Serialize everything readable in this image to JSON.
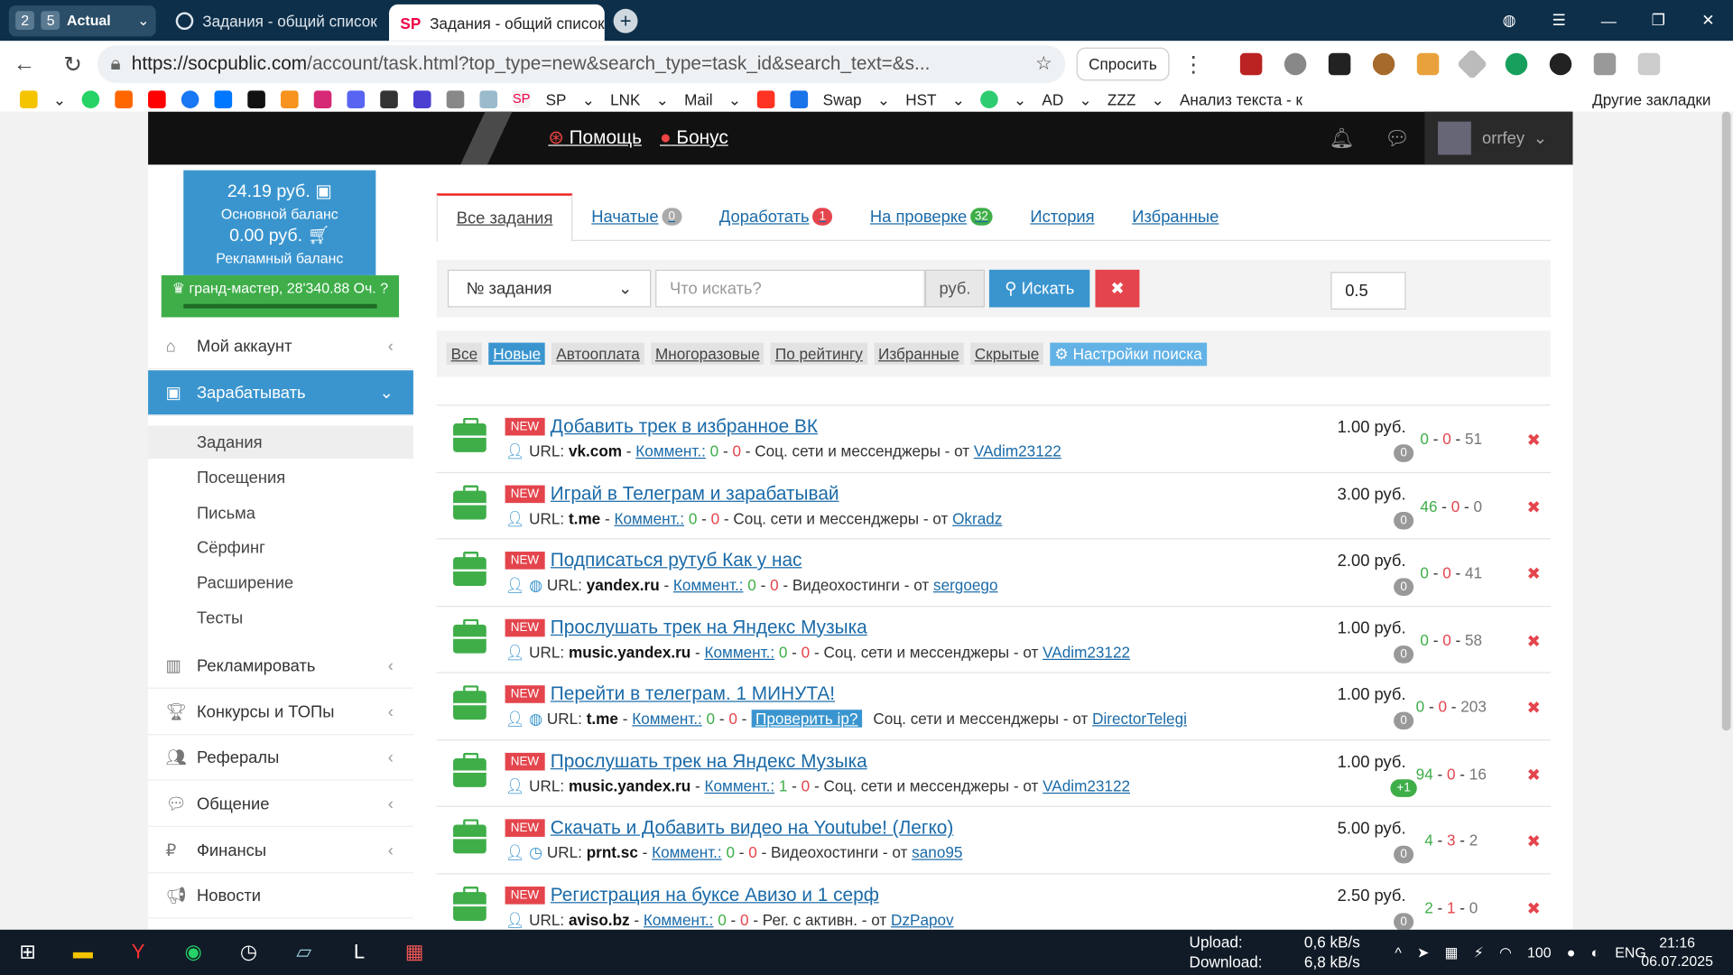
{
  "browser": {
    "workspace": {
      "number": "2",
      "count": "5",
      "name": "Actual"
    },
    "tabs": [
      {
        "label": "Задания - общий список"
      },
      {
        "label": "Задания - общий список"
      }
    ],
    "url_host": "https://socpublic.com",
    "url_rest": "/account/task.html?top_type=new&search_type=task_id&search_text=&s...",
    "ask_label": "Спросить",
    "bookmarks": [
      "SP",
      "LNK",
      "Mail",
      "Swap",
      "HST",
      "AD",
      "ZZZ",
      "Анализ текста - к"
    ],
    "other_bookmarks": "Другие закладки"
  },
  "site": {
    "help": "Помощь",
    "bonus": "Бонус",
    "username": "orrfey",
    "balance_main": "24.19 руб.",
    "balance_main_label": "Основной баланс",
    "balance_ad": "0.00 руб.",
    "balance_ad_label": "Рекламный баланс",
    "rank": "гранд-мастер, 28'340.88 Оч."
  },
  "sidebar": {
    "items": [
      {
        "label": "Мой аккаунт",
        "icon": "home-icon"
      },
      {
        "label": "Зарабатывать",
        "icon": "briefcase-icon"
      },
      {
        "label": "Рекламировать",
        "icon": "chart-icon"
      },
      {
        "label": "Конкурсы и ТОПы",
        "icon": "trophy-icon"
      },
      {
        "label": "Рефералы",
        "icon": "users-icon"
      },
      {
        "label": "Общение",
        "icon": "chat-icon"
      },
      {
        "label": "Финансы",
        "icon": "ruble-icon"
      },
      {
        "label": "Новости",
        "icon": "megaphone-icon"
      }
    ],
    "subitems": [
      "Задания",
      "Посещения",
      "Письма",
      "Сёрфинг",
      "Расширение",
      "Тесты"
    ]
  },
  "main": {
    "tabs": [
      {
        "label": "Все задания"
      },
      {
        "label": "Начатые",
        "badge": "0"
      },
      {
        "label": "Доработать",
        "badge": "1"
      },
      {
        "label": "На проверке",
        "badge": "32"
      },
      {
        "label": "История"
      },
      {
        "label": "Избранные"
      }
    ],
    "search": {
      "type": "№ задания",
      "placeholder": "Что искать?",
      "price": "0.5",
      "currency": "руб.",
      "button": "Искать"
    },
    "filters": [
      "Все",
      "Новые",
      "Автооплата",
      "Многоразовые",
      "По рейтингу",
      "Избранные",
      "Скрытые",
      "Настройки поиска"
    ]
  },
  "tasks": [
    {
      "badge": "NEW",
      "title": "Добавить трек в избранное ВК",
      "url": "vk.com",
      "comment": "Коммент.:",
      "c1": "0",
      "c2": "0",
      "category": "Соц. сети и мессенджеры",
      "author": "VAdim23122",
      "price": "1.00 руб.",
      "count": "0",
      "s1": "0",
      "s2": "0",
      "s3": "51"
    },
    {
      "badge": "NEW",
      "title": "Играй в Телеграм и зарабатывай",
      "url": "t.me",
      "comment": "Коммент.:",
      "c1": "0",
      "c2": "0",
      "category": "Соц. сети и мессенджеры",
      "author": "Okradz",
      "price": "3.00 руб.",
      "count": "0",
      "s1": "46",
      "s2": "0",
      "s3": "0"
    },
    {
      "badge": "NEW",
      "title": "Подписаться рутуб Как у нас",
      "url": "yandex.ru",
      "comment": "Коммент.:",
      "c1": "0",
      "c2": "0",
      "category": "Видеохостинги",
      "author": "sergoego",
      "price": "2.00 руб.",
      "count": "0",
      "s1": "0",
      "s2": "0",
      "s3": "41"
    },
    {
      "badge": "NEW",
      "title": "Прослушать трек на Яндекс Музыка",
      "url": "music.yandex.ru",
      "comment": "Коммент.:",
      "c1": "0",
      "c2": "0",
      "category": "Соц. сети и мессенджеры",
      "author": "VAdim23122",
      "price": "1.00 руб.",
      "count": "0",
      "s1": "0",
      "s2": "0",
      "s3": "58"
    },
    {
      "badge": "NEW",
      "title": "Перейти в телеграм. 1 МИНУТА!",
      "url": "t.me",
      "comment": "Коммент.:",
      "c1": "0",
      "c2": "0",
      "check": "Проверить ip?",
      "category": "Соц. сети и мессенджеры",
      "author": "DirectorTelegi",
      "price": "1.00 руб.",
      "count": "0",
      "s1": "0",
      "s2": "0",
      "s3": "203"
    },
    {
      "badge": "NEW",
      "title": "Прослушать трек на Яндекс Музыка",
      "url": "music.yandex.ru",
      "comment": "Коммент.:",
      "c1": "1",
      "c2": "0",
      "category": "Соц. сети и мессенджеры",
      "author": "VAdim23122",
      "price": "1.00 руб.",
      "count": "+1",
      "s1": "94",
      "s2": "0",
      "s3": "16"
    },
    {
      "badge": "NEW",
      "title": "Скачать и Добавить видео на Youtube! (Легко)",
      "url": "prnt.sc",
      "comment": "Коммент.:",
      "c1": "0",
      "c2": "0",
      "category": "Видеохостинги",
      "author": "sano95",
      "price": "5.00 руб.",
      "count": "0",
      "s1": "4",
      "s2": "3",
      "s3": "2"
    },
    {
      "badge": "NEW",
      "title": "Регистрация на буксе Авизо и 1 серф",
      "url": "aviso.bz",
      "comment": "Коммент.:",
      "c1": "0",
      "c2": "0",
      "category": "Рег. с активн.",
      "author": "DzPapov",
      "price": "2.50 руб.",
      "count": "0",
      "s1": "2",
      "s2": "1",
      "s3": "0"
    }
  ],
  "taskbar": {
    "upload_label": "Upload:",
    "download_label": "Download:",
    "upload": "0,6 kB/s",
    "download": "6,8 kB/s",
    "lang": "ENG",
    "time": "21:16",
    "date": "06.07.2025",
    "battery": "100"
  }
}
